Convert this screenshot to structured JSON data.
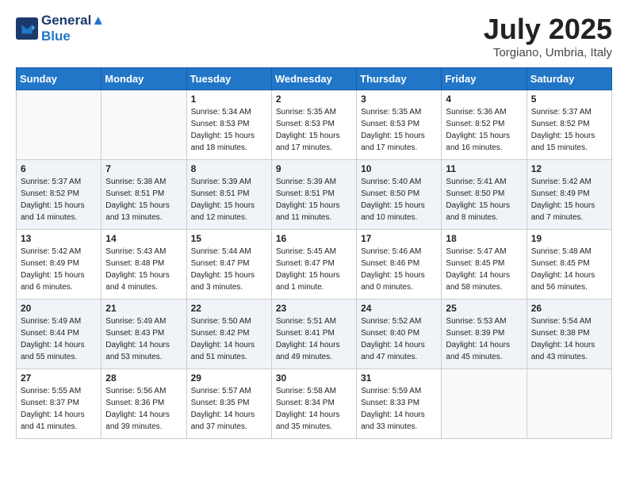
{
  "header": {
    "logo_line1": "General",
    "logo_line2": "Blue",
    "month_year": "July 2025",
    "location": "Torgiano, Umbria, Italy"
  },
  "days_of_week": [
    "Sunday",
    "Monday",
    "Tuesday",
    "Wednesday",
    "Thursday",
    "Friday",
    "Saturday"
  ],
  "weeks": [
    [
      {
        "num": "",
        "sunrise": "",
        "sunset": "",
        "daylight": ""
      },
      {
        "num": "",
        "sunrise": "",
        "sunset": "",
        "daylight": ""
      },
      {
        "num": "1",
        "sunrise": "Sunrise: 5:34 AM",
        "sunset": "Sunset: 8:53 PM",
        "daylight": "Daylight: 15 hours and 18 minutes."
      },
      {
        "num": "2",
        "sunrise": "Sunrise: 5:35 AM",
        "sunset": "Sunset: 8:53 PM",
        "daylight": "Daylight: 15 hours and 17 minutes."
      },
      {
        "num": "3",
        "sunrise": "Sunrise: 5:35 AM",
        "sunset": "Sunset: 8:53 PM",
        "daylight": "Daylight: 15 hours and 17 minutes."
      },
      {
        "num": "4",
        "sunrise": "Sunrise: 5:36 AM",
        "sunset": "Sunset: 8:52 PM",
        "daylight": "Daylight: 15 hours and 16 minutes."
      },
      {
        "num": "5",
        "sunrise": "Sunrise: 5:37 AM",
        "sunset": "Sunset: 8:52 PM",
        "daylight": "Daylight: 15 hours and 15 minutes."
      }
    ],
    [
      {
        "num": "6",
        "sunrise": "Sunrise: 5:37 AM",
        "sunset": "Sunset: 8:52 PM",
        "daylight": "Daylight: 15 hours and 14 minutes."
      },
      {
        "num": "7",
        "sunrise": "Sunrise: 5:38 AM",
        "sunset": "Sunset: 8:51 PM",
        "daylight": "Daylight: 15 hours and 13 minutes."
      },
      {
        "num": "8",
        "sunrise": "Sunrise: 5:39 AM",
        "sunset": "Sunset: 8:51 PM",
        "daylight": "Daylight: 15 hours and 12 minutes."
      },
      {
        "num": "9",
        "sunrise": "Sunrise: 5:39 AM",
        "sunset": "Sunset: 8:51 PM",
        "daylight": "Daylight: 15 hours and 11 minutes."
      },
      {
        "num": "10",
        "sunrise": "Sunrise: 5:40 AM",
        "sunset": "Sunset: 8:50 PM",
        "daylight": "Daylight: 15 hours and 10 minutes."
      },
      {
        "num": "11",
        "sunrise": "Sunrise: 5:41 AM",
        "sunset": "Sunset: 8:50 PM",
        "daylight": "Daylight: 15 hours and 8 minutes."
      },
      {
        "num": "12",
        "sunrise": "Sunrise: 5:42 AM",
        "sunset": "Sunset: 8:49 PM",
        "daylight": "Daylight: 15 hours and 7 minutes."
      }
    ],
    [
      {
        "num": "13",
        "sunrise": "Sunrise: 5:42 AM",
        "sunset": "Sunset: 8:49 PM",
        "daylight": "Daylight: 15 hours and 6 minutes."
      },
      {
        "num": "14",
        "sunrise": "Sunrise: 5:43 AM",
        "sunset": "Sunset: 8:48 PM",
        "daylight": "Daylight: 15 hours and 4 minutes."
      },
      {
        "num": "15",
        "sunrise": "Sunrise: 5:44 AM",
        "sunset": "Sunset: 8:47 PM",
        "daylight": "Daylight: 15 hours and 3 minutes."
      },
      {
        "num": "16",
        "sunrise": "Sunrise: 5:45 AM",
        "sunset": "Sunset: 8:47 PM",
        "daylight": "Daylight: 15 hours and 1 minute."
      },
      {
        "num": "17",
        "sunrise": "Sunrise: 5:46 AM",
        "sunset": "Sunset: 8:46 PM",
        "daylight": "Daylight: 15 hours and 0 minutes."
      },
      {
        "num": "18",
        "sunrise": "Sunrise: 5:47 AM",
        "sunset": "Sunset: 8:45 PM",
        "daylight": "Daylight: 14 hours and 58 minutes."
      },
      {
        "num": "19",
        "sunrise": "Sunrise: 5:48 AM",
        "sunset": "Sunset: 8:45 PM",
        "daylight": "Daylight: 14 hours and 56 minutes."
      }
    ],
    [
      {
        "num": "20",
        "sunrise": "Sunrise: 5:49 AM",
        "sunset": "Sunset: 8:44 PM",
        "daylight": "Daylight: 14 hours and 55 minutes."
      },
      {
        "num": "21",
        "sunrise": "Sunrise: 5:49 AM",
        "sunset": "Sunset: 8:43 PM",
        "daylight": "Daylight: 14 hours and 53 minutes."
      },
      {
        "num": "22",
        "sunrise": "Sunrise: 5:50 AM",
        "sunset": "Sunset: 8:42 PM",
        "daylight": "Daylight: 14 hours and 51 minutes."
      },
      {
        "num": "23",
        "sunrise": "Sunrise: 5:51 AM",
        "sunset": "Sunset: 8:41 PM",
        "daylight": "Daylight: 14 hours and 49 minutes."
      },
      {
        "num": "24",
        "sunrise": "Sunrise: 5:52 AM",
        "sunset": "Sunset: 8:40 PM",
        "daylight": "Daylight: 14 hours and 47 minutes."
      },
      {
        "num": "25",
        "sunrise": "Sunrise: 5:53 AM",
        "sunset": "Sunset: 8:39 PM",
        "daylight": "Daylight: 14 hours and 45 minutes."
      },
      {
        "num": "26",
        "sunrise": "Sunrise: 5:54 AM",
        "sunset": "Sunset: 8:38 PM",
        "daylight": "Daylight: 14 hours and 43 minutes."
      }
    ],
    [
      {
        "num": "27",
        "sunrise": "Sunrise: 5:55 AM",
        "sunset": "Sunset: 8:37 PM",
        "daylight": "Daylight: 14 hours and 41 minutes."
      },
      {
        "num": "28",
        "sunrise": "Sunrise: 5:56 AM",
        "sunset": "Sunset: 8:36 PM",
        "daylight": "Daylight: 14 hours and 39 minutes."
      },
      {
        "num": "29",
        "sunrise": "Sunrise: 5:57 AM",
        "sunset": "Sunset: 8:35 PM",
        "daylight": "Daylight: 14 hours and 37 minutes."
      },
      {
        "num": "30",
        "sunrise": "Sunrise: 5:58 AM",
        "sunset": "Sunset: 8:34 PM",
        "daylight": "Daylight: 14 hours and 35 minutes."
      },
      {
        "num": "31",
        "sunrise": "Sunrise: 5:59 AM",
        "sunset": "Sunset: 8:33 PM",
        "daylight": "Daylight: 14 hours and 33 minutes."
      },
      {
        "num": "",
        "sunrise": "",
        "sunset": "",
        "daylight": ""
      },
      {
        "num": "",
        "sunrise": "",
        "sunset": "",
        "daylight": ""
      }
    ]
  ]
}
